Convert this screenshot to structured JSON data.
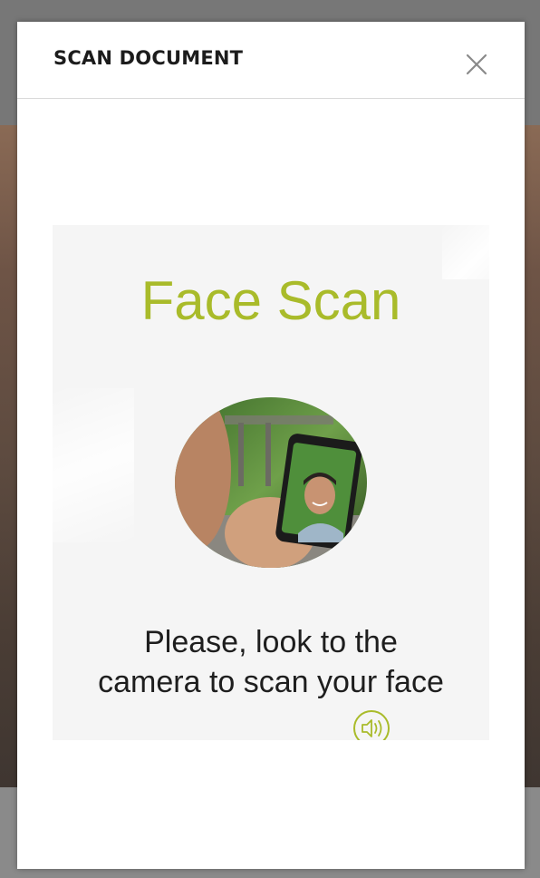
{
  "modal": {
    "title": "SCAN DOCUMENT",
    "close_icon": "close-icon"
  },
  "scan": {
    "heading": "Face Scan",
    "instruction_line1": "Please, look to the",
    "instruction_line2": "camera to scan your face",
    "audio_icon": "speaker-icon",
    "image": "person-taking-selfie-illustration"
  },
  "colors": {
    "accent": "#a9bb2a",
    "card_background": "#f5f5f5",
    "title_text": "#1c1c1c"
  }
}
